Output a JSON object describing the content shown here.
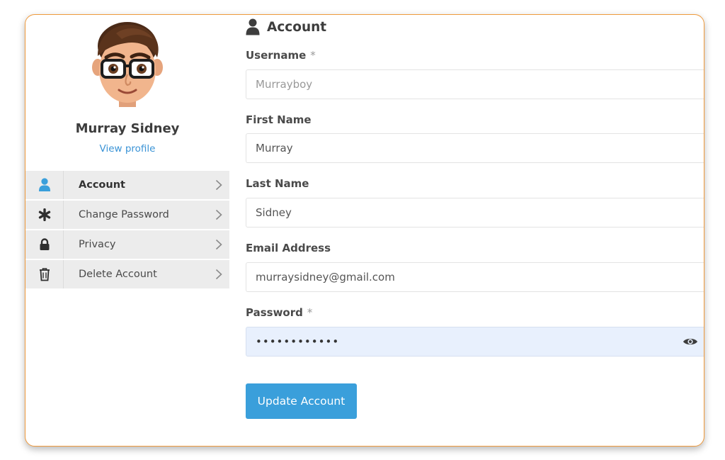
{
  "profile": {
    "name": "Murray Sidney",
    "view_profile_label": "View profile"
  },
  "menu": {
    "items": [
      {
        "label": "Account",
        "icon": "user-icon",
        "active": true
      },
      {
        "label": "Change Password",
        "icon": "asterisk-icon",
        "active": false
      },
      {
        "label": "Privacy",
        "icon": "lock-icon",
        "active": false
      },
      {
        "label": "Delete Account",
        "icon": "trash-icon",
        "active": false
      }
    ]
  },
  "form": {
    "title": "Account",
    "title_icon": "user-icon",
    "username": {
      "label": "Username",
      "required_mark": "*",
      "value": "",
      "placeholder": "Murrayboy"
    },
    "first_name": {
      "label": "First Name",
      "value": "Murray"
    },
    "last_name": {
      "label": "Last Name",
      "value": "Sidney"
    },
    "email": {
      "label": "Email Address",
      "value": "murraysidney@gmail.com"
    },
    "password": {
      "label": "Password",
      "required_mark": "*",
      "value": "passwordabc1",
      "toggle_icon": "eye-icon"
    },
    "submit_label": "Update Account"
  },
  "colors": {
    "accent": "#3a9fdb",
    "card_border": "#ef9a3c",
    "link": "#3a93d6",
    "password_bg": "#e8f0fd"
  }
}
